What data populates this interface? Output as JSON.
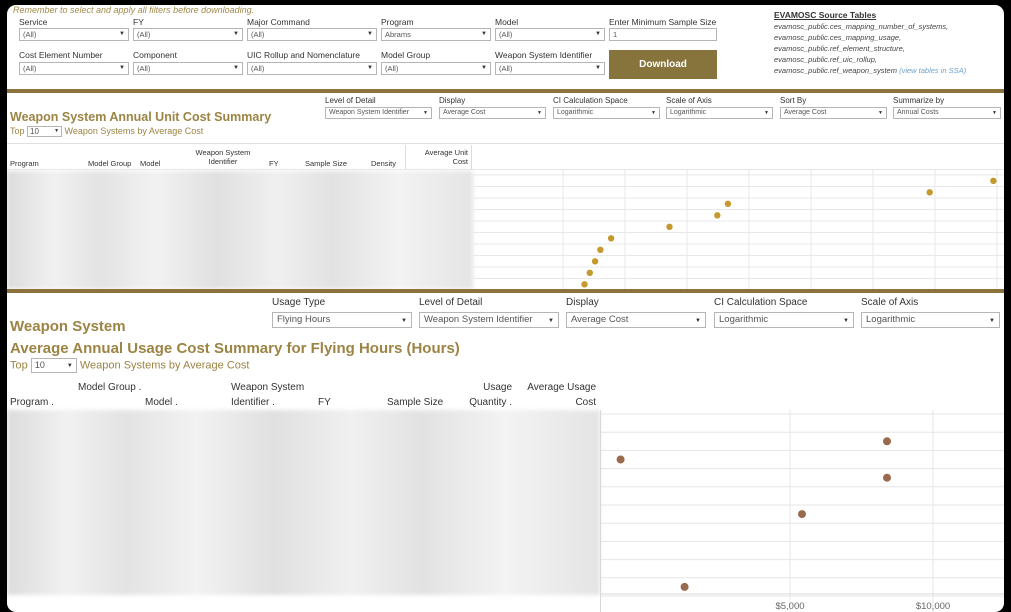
{
  "filters": {
    "reminder": "Remember to select and apply all filters before downloading.",
    "row1": [
      {
        "label": "Service",
        "value": "(All)"
      },
      {
        "label": "FY",
        "value": "(All)"
      },
      {
        "label": "Major Command",
        "value": "(All)"
      },
      {
        "label": "Program",
        "value": "Abrams"
      },
      {
        "label": "Model",
        "value": "(All)"
      }
    ],
    "row2": [
      {
        "label": "Cost Element Number",
        "value": "(All)"
      },
      {
        "label": "Component",
        "value": "(All)"
      },
      {
        "label": "UIC Rollup and Nomenclature",
        "value": "(All)"
      },
      {
        "label": "Model Group",
        "value": "(All)"
      },
      {
        "label": "Weapon System Identifier",
        "value": "(All)"
      }
    ],
    "min_sample_label": "Enter Minimum Sample Size",
    "min_sample_value": "1",
    "download_label": "Download"
  },
  "source_tables": {
    "title": "EVAMOSC Source Tables",
    "lines": [
      "evamosc_public.ces_mapping_number_of_systems,",
      "evamosc_public.ces_mapping_usage,",
      "evamosc_public.ref_element_structure,",
      "evamosc_public.ref_uic_rollup,",
      "evamosc_public.ref_weapon_system"
    ],
    "link_text": "(view tables in SSA)"
  },
  "unit_cost": {
    "title": "Weapon System Annual Unit Cost Summary",
    "top_prefix": "Top",
    "top_value": "10",
    "top_suffix": "Weapon Systems by Average Cost",
    "controls": [
      {
        "label": "Level of Detail",
        "value": "Weapon System Identifier"
      },
      {
        "label": "Display",
        "value": "Average Cost"
      },
      {
        "label": "CI Calculation Space",
        "value": "Logarithmic"
      },
      {
        "label": "Scale of Axis",
        "value": "Logarithmic"
      },
      {
        "label": "Sort By",
        "value": "Average Cost"
      },
      {
        "label": "Summarize by",
        "value": "Annual Costs"
      }
    ],
    "columns": [
      "Program",
      "Model Group",
      "Model",
      "Weapon System Identifier",
      "FY",
      "Sample Size",
      "Density",
      "Average Unit Cost"
    ]
  },
  "usage_cost": {
    "title_line1": "Weapon System",
    "title_line2": "Average Annual Usage Cost Summary for Flying Hours (Hours)",
    "top_prefix": "Top",
    "top_value": "10",
    "top_suffix": "Weapon Systems by Average Cost",
    "controls": [
      {
        "label": "Usage Type",
        "value": "Flying Hours"
      },
      {
        "label": "Level of Detail",
        "value": "Weapon System Identifier"
      },
      {
        "label": "Display",
        "value": "Average Cost"
      },
      {
        "label": "CI Calculation Space",
        "value": "Logarithmic"
      },
      {
        "label": "Scale of Axis",
        "value": "Logarithmic"
      }
    ],
    "columns": [
      "Program .",
      "Model Group .",
      "Model .",
      "Weapon System Identifier .",
      "FY",
      "Sample Size",
      "Usage Quantity .",
      "Average Usage Cost"
    ]
  },
  "chart_data": [
    {
      "type": "scatter",
      "title": "",
      "note": "unit cost dot plot, one row per weapon system; axis tick labels not visible",
      "rows": 10,
      "row_index": [
        1,
        2,
        3,
        4,
        5,
        6,
        7,
        8,
        9,
        10
      ],
      "relative_position": [
        0.98,
        0.86,
        0.48,
        0.46,
        0.37,
        0.26,
        0.24,
        0.23,
        0.22,
        0.21
      ]
    },
    {
      "type": "scatter",
      "title": "",
      "xlabel": "",
      "x_tick_labels": [
        "$5,000",
        "$10,000"
      ],
      "x_ticks": [
        5000,
        10000
      ],
      "scale": "log",
      "rows": 10,
      "values": [
        {
          "row": 2,
          "x": 8000
        },
        {
          "row": 3,
          "x": 2200
        },
        {
          "row": 4,
          "x": 8000
        },
        {
          "row": 6,
          "x": 5300
        },
        {
          "row": 10,
          "x": 3000
        }
      ],
      "dot_color": "#9a6a4c"
    }
  ],
  "colors": {
    "gold": "#9c8444",
    "rule": "#8b733b",
    "dot_unit": "#c5992e",
    "dot_usage": "#9a6a4c"
  }
}
